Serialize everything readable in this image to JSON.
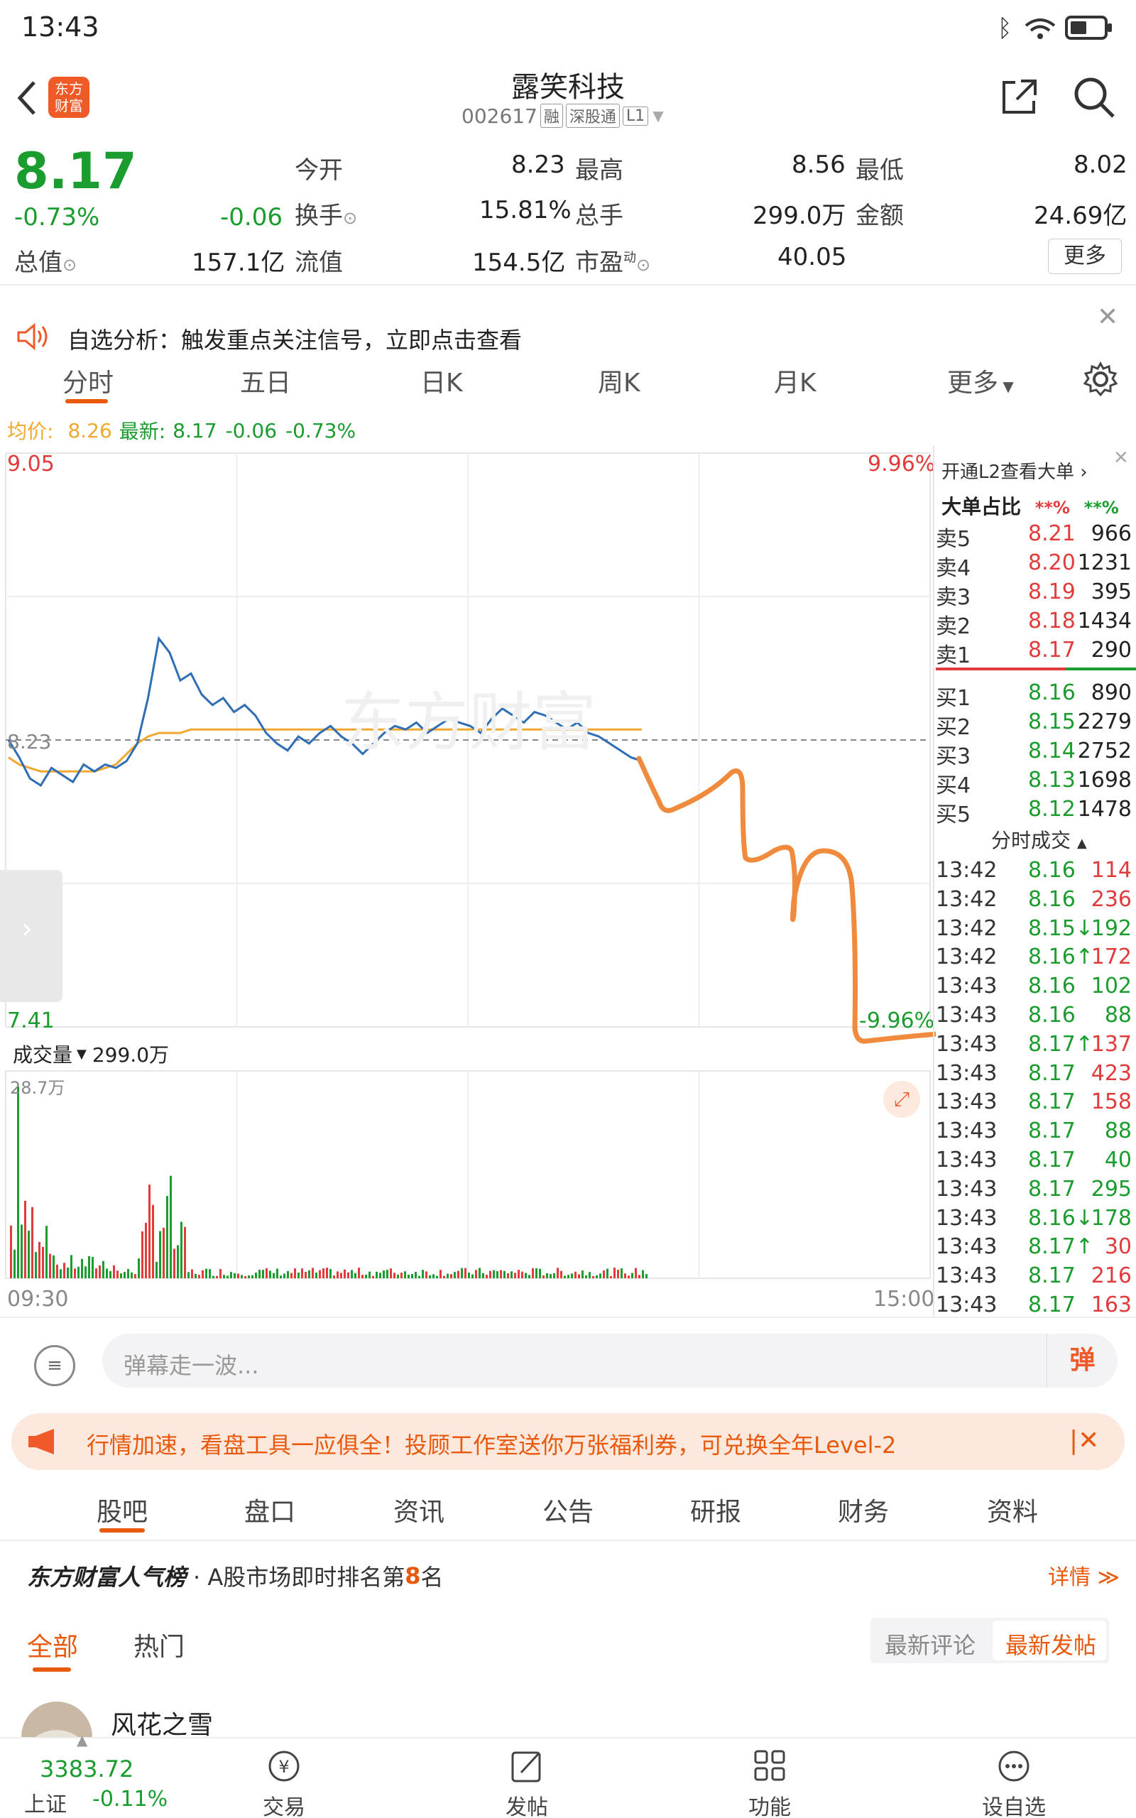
{
  "status": {
    "time": "13:43"
  },
  "header": {
    "logo_text": "东方财富",
    "stock_name": "露笑科技",
    "stock_code": "002617",
    "tags": [
      "融",
      "深股通",
      "L1"
    ]
  },
  "quote": {
    "price": "8.17",
    "change_pct": "-0.73%",
    "change": "-0.06",
    "open_label": "今开",
    "open": "8.23",
    "high_label": "最高",
    "high": "8.56",
    "low_label": "最低",
    "low": "8.02",
    "turnover_label": "换手",
    "turnover": "15.81%",
    "volume_label": "总手",
    "volume": "299.0万",
    "amount_label": "金额",
    "amount": "24.69亿",
    "mktcap_label": "总值",
    "mktcap": "157.1亿",
    "float_label": "流值",
    "float_cap": "154.5亿",
    "pe_label": "市盈",
    "pe_sup": "动",
    "pe": "40.05",
    "more_label": "更多"
  },
  "notice": {
    "text": "自选分析：触发重点关注信号，立即点击查看"
  },
  "ktabs": [
    "分时",
    "五日",
    "日K",
    "周K",
    "月K",
    "更多"
  ],
  "chart_info": {
    "avg_label": "均价:",
    "avg": "8.26",
    "latest_label": "最新:",
    "latest": "8.17",
    "latest_change": "-0.06",
    "latest_pct": "-0.73%"
  },
  "chart_data": {
    "type": "line",
    "y_top": "9.05",
    "y_bottom": "7.41",
    "pct_top": "9.96%",
    "pct_bottom": "-9.96%",
    "prev_close": "8.23",
    "x_start": "09:30",
    "x_end": "15:00",
    "ylim": [
      7.41,
      9.05
    ],
    "price_series": [
      8.23,
      8.18,
      8.12,
      8.1,
      8.15,
      8.13,
      8.11,
      8.16,
      8.14,
      8.16,
      8.15,
      8.17,
      8.22,
      8.35,
      8.52,
      8.48,
      8.4,
      8.42,
      8.36,
      8.33,
      8.35,
      8.31,
      8.33,
      8.3,
      8.25,
      8.22,
      8.2,
      8.24,
      8.22,
      8.25,
      8.27,
      8.24,
      8.22,
      8.19,
      8.22,
      8.25,
      8.27,
      8.26,
      8.28,
      8.25,
      8.27,
      8.29,
      8.28,
      8.27,
      8.25,
      8.29,
      8.32,
      8.3,
      8.28,
      8.31,
      8.3,
      8.28,
      8.26,
      8.28,
      8.25,
      8.24,
      8.22,
      8.2,
      8.18,
      8.17
    ],
    "avg_series": [
      8.18,
      8.16,
      8.15,
      8.14,
      8.14,
      8.14,
      8.14,
      8.14,
      8.14,
      8.15,
      8.16,
      8.19,
      8.22,
      8.24,
      8.25,
      8.25,
      8.25,
      8.26,
      8.26,
      8.26,
      8.26,
      8.26,
      8.26,
      8.26,
      8.26,
      8.26,
      8.26,
      8.26,
      8.26,
      8.26,
      8.26,
      8.26,
      8.26,
      8.26,
      8.26,
      8.26,
      8.26,
      8.26,
      8.26,
      8.26,
      8.26,
      8.26,
      8.26,
      8.26,
      8.26,
      8.26,
      8.26,
      8.26,
      8.26,
      8.26,
      8.26,
      8.26,
      8.26,
      8.26,
      8.26,
      8.26,
      8.26,
      8.26,
      8.26,
      8.26
    ],
    "volume_label": "成交量",
    "volume_total": "299.0万",
    "volume_max": "28.7万",
    "colors": {
      "price": "#2f6db5",
      "avg": "#f0a830",
      "up": "#e23b3b",
      "down": "#1a9d2e",
      "annotation": "#f08a3c"
    }
  },
  "orderbook": {
    "header": "开通L2查看大单",
    "ratio_label": "大单占比",
    "ratio_a": "**%",
    "ratio_b": "**%",
    "sells": [
      {
        "label": "卖5",
        "price": "8.21",
        "vol": "966"
      },
      {
        "label": "卖4",
        "price": "8.20",
        "vol": "1231"
      },
      {
        "label": "卖3",
        "price": "8.19",
        "vol": "395"
      },
      {
        "label": "卖2",
        "price": "8.18",
        "vol": "1434"
      },
      {
        "label": "卖1",
        "price": "8.17",
        "vol": "290"
      }
    ],
    "buys": [
      {
        "label": "买1",
        "price": "8.16",
        "vol": "890"
      },
      {
        "label": "买2",
        "price": "8.15",
        "vol": "2279"
      },
      {
        "label": "买3",
        "price": "8.14",
        "vol": "2752"
      },
      {
        "label": "买4",
        "price": "8.13",
        "vol": "1698"
      },
      {
        "label": "买5",
        "price": "8.12",
        "vol": "1478"
      }
    ],
    "trades_title": "分时成交",
    "trades": [
      {
        "time": "13:42",
        "price": "8.16",
        "vol": "114",
        "dir": "up"
      },
      {
        "time": "13:42",
        "price": "8.16",
        "vol": "236",
        "dir": "up"
      },
      {
        "time": "13:42",
        "price": "8.15↓",
        "vol": "192",
        "dir": "down"
      },
      {
        "time": "13:42",
        "price": "8.16↑",
        "vol": "172",
        "dir": "up"
      },
      {
        "time": "13:43",
        "price": "8.16",
        "vol": "102",
        "dir": "down"
      },
      {
        "time": "13:43",
        "price": "8.16",
        "vol": "88",
        "dir": "down"
      },
      {
        "time": "13:43",
        "price": "8.17↑",
        "vol": "137",
        "dir": "up"
      },
      {
        "time": "13:43",
        "price": "8.17",
        "vol": "423",
        "dir": "up"
      },
      {
        "time": "13:43",
        "price": "8.17",
        "vol": "158",
        "dir": "up"
      },
      {
        "time": "13:43",
        "price": "8.17",
        "vol": "88",
        "dir": "down"
      },
      {
        "time": "13:43",
        "price": "8.17",
        "vol": "40",
        "dir": "down"
      },
      {
        "time": "13:43",
        "price": "8.17",
        "vol": "295",
        "dir": "down"
      },
      {
        "time": "13:43",
        "price": "8.16↓",
        "vol": "178",
        "dir": "down"
      },
      {
        "time": "13:43",
        "price": "8.17↑",
        "vol": "30",
        "dir": "up"
      },
      {
        "time": "13:43",
        "price": "8.17",
        "vol": "216",
        "dir": "up"
      },
      {
        "time": "13:43",
        "price": "8.17",
        "vol": "163",
        "dir": "up"
      }
    ]
  },
  "danmu": {
    "placeholder": "弹幕走一波...",
    "button": "弹"
  },
  "promo": {
    "text": "行情加速，看盘工具一应俱全！投顾工作室送你万张福利券，可兑换全年Level-2"
  },
  "section_tabs": [
    "股吧",
    "盘口",
    "资讯",
    "公告",
    "研报",
    "财务",
    "资料"
  ],
  "rank": {
    "brand": "东方财富人气榜",
    "prefix": "· A股市场即时排名第",
    "rank": "8",
    "suffix": "名",
    "detail": "详情"
  },
  "feed_tabs": {
    "all": "全部",
    "hot": "热门",
    "latest_comment": "最新评论",
    "latest_post": "最新发帖"
  },
  "post": {
    "author": "风花之雪"
  },
  "bottom_bar": {
    "index_value": "3383.72",
    "index_name": "上证",
    "index_change": "-0.11%",
    "items": [
      "交易",
      "发帖",
      "功能",
      "设自选"
    ]
  }
}
